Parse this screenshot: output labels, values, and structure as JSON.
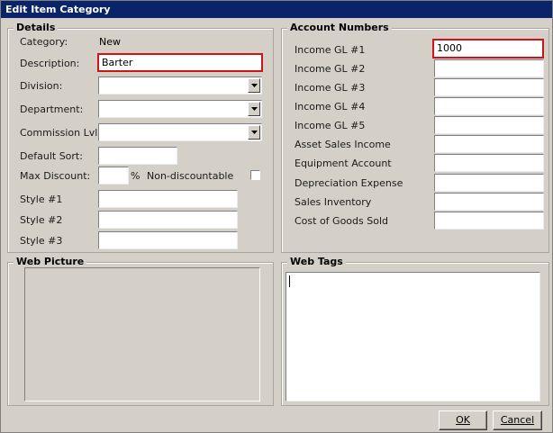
{
  "window": {
    "title": "Edit Item Category"
  },
  "details": {
    "title": "Details",
    "category_label": "Category:",
    "category_value": "New",
    "description_label": "Description:",
    "description_value": "Barter",
    "division_label": "Division:",
    "division_value": "",
    "department_label": "Department:",
    "department_value": "",
    "commission_label": "Commission Lvl:",
    "commission_value": "",
    "default_sort_label": "Default Sort:",
    "default_sort_value": "",
    "max_discount_label": "Max Discount:",
    "max_discount_value": "",
    "percent_sign": "%",
    "non_discountable_label": "Non-discountable",
    "style1_label": "Style #1",
    "style1_value": "",
    "style2_label": "Style #2",
    "style2_value": "",
    "style3_label": "Style #3",
    "style3_value": ""
  },
  "accounts": {
    "title": "Account Numbers",
    "rows": [
      {
        "label": "Income GL #1",
        "value": "1000"
      },
      {
        "label": "Income GL #2",
        "value": ""
      },
      {
        "label": "Income GL #3",
        "value": ""
      },
      {
        "label": "Income GL #4",
        "value": ""
      },
      {
        "label": "Income GL #5",
        "value": ""
      },
      {
        "label": "Asset Sales Income",
        "value": ""
      },
      {
        "label": "Equipment Account",
        "value": ""
      },
      {
        "label": "Depreciation Expense",
        "value": ""
      },
      {
        "label": "Sales Inventory",
        "value": ""
      },
      {
        "label": "Cost of Goods Sold",
        "value": ""
      }
    ]
  },
  "web_picture": {
    "title": "Web Picture"
  },
  "web_tags": {
    "title": "Web Tags",
    "value": ""
  },
  "buttons": {
    "ok": "OK",
    "cancel": "Cancel"
  },
  "icons": {
    "dropdown": "chevron-down-icon"
  }
}
